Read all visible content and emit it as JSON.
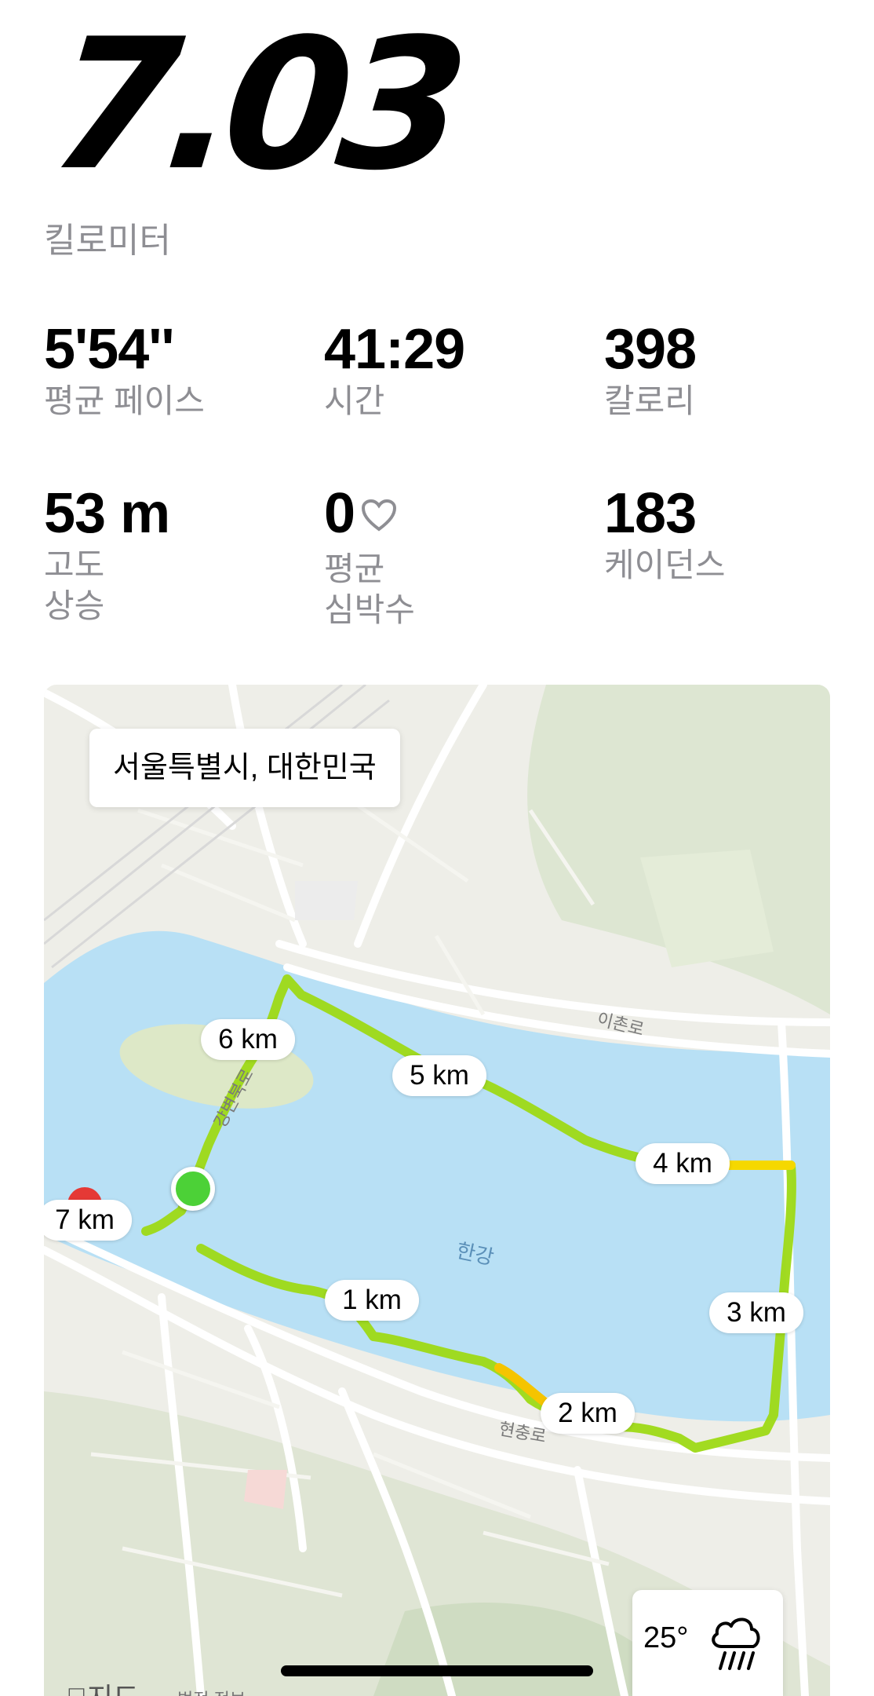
{
  "header": {
    "distance": "7.03",
    "unit": "킬로미터"
  },
  "stats": [
    {
      "value": "5'54''",
      "label": "평균 페이스"
    },
    {
      "value": "41:29",
      "label": "시간"
    },
    {
      "value": "398",
      "label": "칼로리"
    },
    {
      "value": "53 m",
      "label_line1": "고도",
      "label_line2": "상승"
    },
    {
      "value": "0",
      "label_line1": "평균",
      "label_line2": "심박수"
    },
    {
      "value": "183",
      "label": "케이던스"
    }
  ],
  "map": {
    "location": "서울특별시, 대한민국",
    "km_markers": [
      "1 km",
      "2 km",
      "3 km",
      "4 km",
      "5 km",
      "6 km",
      "7 km"
    ],
    "road_labels": {
      "ichon": "이촌로",
      "hyeonchung": "현충로",
      "gangbyeon": "강변북로"
    },
    "river_label": "한강",
    "weather": {
      "temperature": "25°",
      "icon": "rain-cloud-icon"
    },
    "brand": "지도",
    "legal": "법적 정보"
  },
  "colors": {
    "route_green": "#8fd100",
    "route_yellow": "#f5d800",
    "start": "#4cd137",
    "water": "#b8e0f5"
  }
}
